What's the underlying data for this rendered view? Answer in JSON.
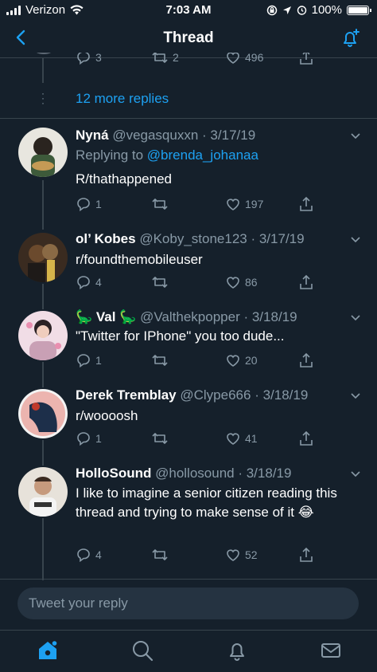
{
  "status_bar": {
    "carrier": "Verizon",
    "time": "7:03 AM",
    "battery": "100%",
    "battery_level": 1.0
  },
  "header": {
    "title": "Thread"
  },
  "colors": {
    "background": "#15202b",
    "accent": "#1da1f2",
    "muted": "#8899a6",
    "divider": "#38444d"
  },
  "top_tweet_actions": {
    "reply_count": "3",
    "retweet_count": "2",
    "like_count": "496"
  },
  "more_replies": {
    "label": "12 more replies"
  },
  "tweets": [
    {
      "name": "Nyná",
      "handle": "@vegasquxxn",
      "date": "· 3/17/19",
      "replying_prefix": "Replying to ",
      "replying_to": "@brenda_johanaa",
      "text": "R/thathappened",
      "replies": "1",
      "retweets": "",
      "likes": "197",
      "avatar_color": "#3d5a3a"
    },
    {
      "name": "ol’ Kobes",
      "handle": "@Koby_stone123",
      "date": "· 3/17/19",
      "text": "r/foundthemobileuser",
      "replies": "4",
      "retweets": "",
      "likes": "86",
      "avatar_color": "#6b4a2d"
    },
    {
      "name": "🦕 Val 🦕",
      "handle": "@Valthekpopper",
      "date": "· 3/18/19",
      "text": "\"Twitter for IPhone\" you too dude...",
      "replies": "1",
      "retweets": "",
      "likes": "20",
      "avatar_color": "#c9a0b5"
    },
    {
      "name": "Derek Tremblay",
      "handle": "@Clype666",
      "date": "· 3/18/19",
      "text": "r/woooosh",
      "replies": "1",
      "retweets": "",
      "likes": "41",
      "avatar_color": "#1d2f4a"
    },
    {
      "name": "HolloSound",
      "handle": "@hollosound",
      "date": "· 3/18/19",
      "text": "I like to imagine a senior citizen reading this thread and trying to make sense of it 😂",
      "replies": "4",
      "retweets": "",
      "likes": "52",
      "avatar_color": "#d8cdb8"
    }
  ],
  "reply_box": {
    "placeholder": "Tweet your reply"
  },
  "icons": {
    "home": "home-icon",
    "search": "search-icon",
    "notifications": "bell-icon",
    "messages": "mail-icon"
  }
}
